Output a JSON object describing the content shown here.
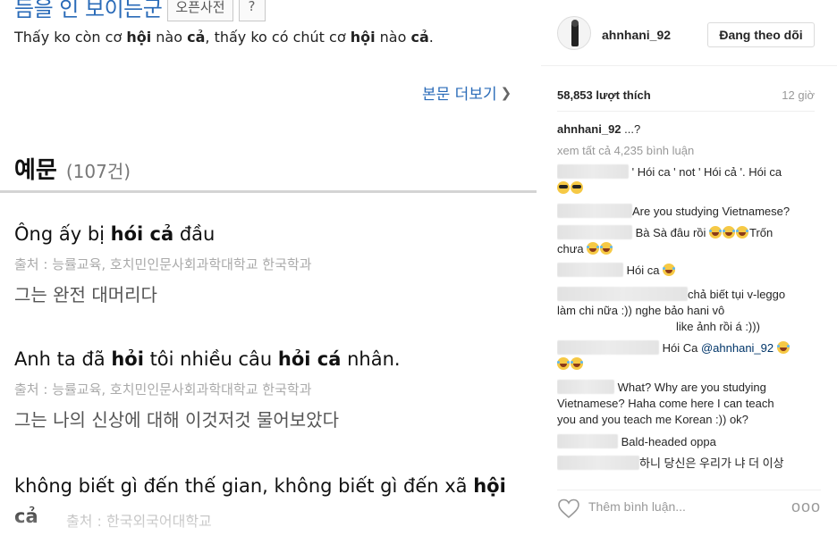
{
  "dictionary": {
    "entry_word": "듬을 인 보이는군",
    "open_dict_label": "오픈사전",
    "help_label": "?",
    "meaning_parts": [
      "Thấy ko còn cơ ",
      "hội",
      " nào ",
      "cả",
      ", thấy ko có chút cơ ",
      "hội",
      " nào ",
      "cả",
      "."
    ],
    "more_link": "본문 더보기",
    "examples_title": "예문",
    "examples_count": "(107건)",
    "examples": [
      {
        "vi_parts": [
          "Ông ấy bị ",
          "hói cả",
          " đầu"
        ],
        "source": "출처 : 능률교육, 호치민인문사회과학대학교 한국학과",
        "ko": "그는 완전 대머리다"
      },
      {
        "vi_parts": [
          "Anh ta đã ",
          "hỏi",
          " tôi nhiều câu ",
          "hỏi cá",
          " nhân."
        ],
        "source": "출처 : 능률교육, 호치민인문사회과학대학교 한국학과",
        "ko": "그는 나의 신상에 대해 이것저것 물어보았다"
      },
      {
        "vi_parts": [
          "không biết gì đến thế gian, không biết gì đến xã ",
          "hội"
        ],
        "vi_line2": "cả",
        "source": "출처 : 한국외국어대학교"
      }
    ]
  },
  "instagram": {
    "username": "ahnhani_92",
    "follow_label": "Đang theo dõi",
    "likes": "58,853 lượt thích",
    "time": "12 giờ",
    "caption_user": "ahnhani_92",
    "caption_text": " ...?",
    "view_all": "xem tất cả 4,235 bình luận",
    "comments": [
      {
        "text": " ' Hói ca ' not ' Hói cả '. Hói ca"
      },
      {
        "text": "Are you studying Vietnamese?"
      },
      {
        "text": " Bà Sà đâu rồi ",
        "text2": "Trốn",
        "line2": "chưa "
      },
      {
        "text": " Hói ca "
      },
      {
        "text": "chả biết tụi v-leggo",
        "line2": "làm chi nữa :)) nghe bảo hani vô",
        "line3": "like ảnh rồi á :)))"
      },
      {
        "text": " Hói Ca ",
        "mention": "@ahnhani_92"
      },
      {
        "text": " What? Why are you studying",
        "line2": "Vietnamese? Haha come here I can teach",
        "line3": "you and you teach me Korean :)) ok?"
      },
      {
        "text": " Bald-headed oppa"
      },
      {
        "text": "하니 당신은 우리가 냐 더 이상"
      }
    ],
    "add_comment_placeholder": "Thêm bình luận...",
    "more_label": "ooo"
  }
}
